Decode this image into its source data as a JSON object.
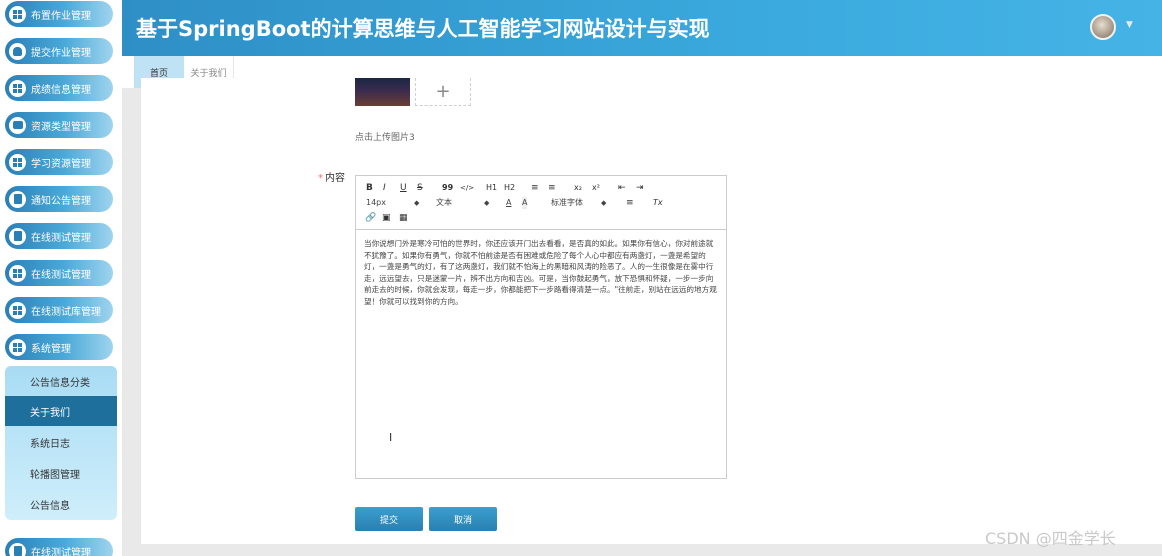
{
  "header": {
    "title": "基于SpringBoot的计算思维与人工智能学习网站设计与实现"
  },
  "sidebar": {
    "items": [
      {
        "label": "布置作业管理",
        "icon": "grid-icon"
      },
      {
        "label": "提交作业管理",
        "icon": "user-icon"
      },
      {
        "label": "成绩信息管理",
        "icon": "grid-icon"
      },
      {
        "label": "资源类型管理",
        "icon": "briefcase-icon"
      },
      {
        "label": "学习资源管理",
        "icon": "grid-icon"
      },
      {
        "label": "通知公告管理",
        "icon": "document-icon"
      },
      {
        "label": "在线测试管理",
        "icon": "document-icon"
      },
      {
        "label": "在线测试管理",
        "icon": "grid-icon"
      },
      {
        "label": "在线测试库管理",
        "icon": "grid-icon"
      },
      {
        "label": "系统管理",
        "icon": "grid-icon"
      },
      {
        "label": "在线测试管理",
        "icon": "trophy-icon"
      }
    ],
    "submenu": [
      {
        "label": "公告信息分类"
      },
      {
        "label": "关于我们",
        "active": true
      },
      {
        "label": "系统日志"
      },
      {
        "label": "轮播图管理"
      },
      {
        "label": "公告信息"
      }
    ]
  },
  "tabs": [
    {
      "label": "首页",
      "active": true
    },
    {
      "label": "关于我们"
    }
  ],
  "form": {
    "upload_hint": "点击上传图片3",
    "upload_plus": "+",
    "content_label": "内容",
    "required_mark": "*",
    "toolbar": {
      "row1": [
        "B",
        "I",
        "U",
        "S",
        "99",
        "</>",
        "H1",
        "H2",
        "≡",
        "≡",
        "x₂",
        "x²",
        "⇤",
        "⇥"
      ],
      "font_size": "14px",
      "text_type": "文本",
      "color_a": "A",
      "bg_color": "A",
      "font_family": "标准字体",
      "align": "≡",
      "clear_format": "Tx"
    },
    "content_text": "当你说想门外是寒冷可怕的世界时，你还应该开门出去看看，是否真的如此。如果你有信心，你对前途就不犹豫了。如果你有勇气，你就不怕前途是否有困难或危险了每个人心中都应有两盏灯，一盏是希望的灯，一盏是勇气的灯，有了这两盏灯，我们就不怕海上的黑暗和风涛的险恶了。人的一生很像是在雾中行走，远远望去，只是迷蒙一片，辨不出方向和吉凶。可是，当你鼓起勇气，放下恐惧和怀疑，一步一步向前走去的时候，你就会发现，每走一步，你都能把下一步路看得清楚一点。\"往前走，别站在远远的地方观望！你就可以找到你的方向。"
  },
  "buttons": {
    "submit": "提交",
    "cancel": "取消"
  },
  "watermark": "CSDN @四金学长"
}
